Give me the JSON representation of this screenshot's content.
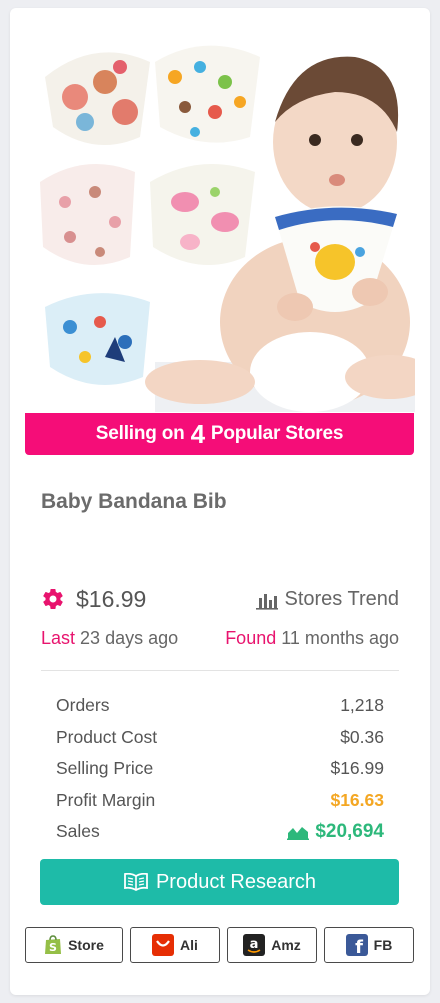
{
  "product": {
    "image_alt": "baby-bandana-bibs-photo",
    "banner": {
      "prefix": "Selling on",
      "count": "4",
      "suffix": "Popular Stores"
    },
    "title": "Baby Bandana Bib",
    "price": "$16.99",
    "stores_trend_label": "Stores Trend",
    "last": {
      "label": "Last",
      "value": "23 days ago"
    },
    "found": {
      "label": "Found",
      "value": "11 months ago"
    }
  },
  "stats": [
    {
      "label": "Orders",
      "value": "1,218"
    },
    {
      "label": "Product Cost",
      "value": "$0.36"
    },
    {
      "label": "Selling Price",
      "value": "$16.99"
    },
    {
      "label": "Profit Margin",
      "value": "$16.63"
    },
    {
      "label": "Sales",
      "value": "$20,694"
    }
  ],
  "actions": {
    "research_label": "Product Research",
    "store_links": [
      {
        "label": "Store",
        "icon": "shopify-bag-icon"
      },
      {
        "label": "Ali",
        "icon": "aliexpress-icon"
      },
      {
        "label": "Amz",
        "icon": "amazon-icon"
      },
      {
        "label": "FB",
        "icon": "facebook-icon"
      }
    ]
  },
  "colors": {
    "accent_pink": "#f50d78",
    "teal": "#1ebba8",
    "orange": "#f4a723",
    "green": "#2db87b"
  }
}
